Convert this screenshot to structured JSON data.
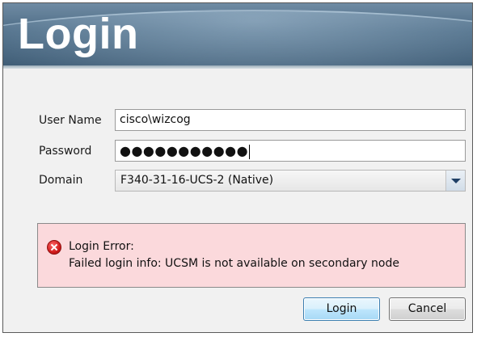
{
  "window": {
    "title": "Login"
  },
  "form": {
    "username_label": "User Name",
    "username_value": "cisco\\wizcog",
    "password_label": "Password",
    "password_masked": "●●●●●●●●●●●",
    "domain_label": "Domain",
    "domain_value": "F340-31-16-UCS-2 (Native)"
  },
  "error": {
    "title": "Login Error:",
    "message": "Failed login info: UCSM is not available on secondary node"
  },
  "buttons": {
    "login_label": "Login",
    "cancel_label": "Cancel"
  },
  "colors": {
    "header": "#4d6c86",
    "error_background": "#fbd9dc",
    "error_icon": "#d01c1c",
    "primary_button_border": "#3c7fb1"
  }
}
